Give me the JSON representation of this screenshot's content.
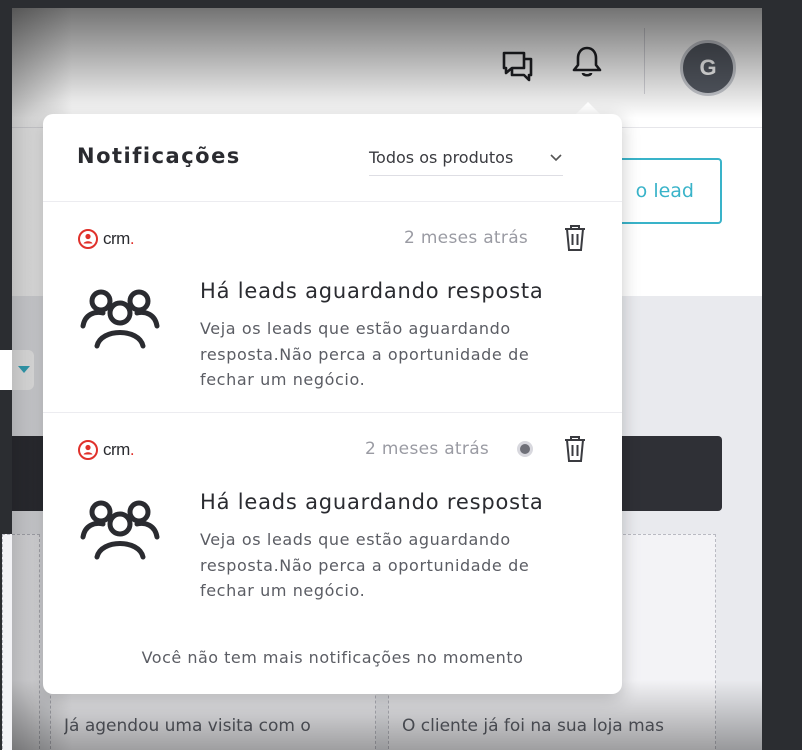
{
  "header": {
    "chat_icon": "chat-bubbles-icon",
    "bell_icon": "bell-icon",
    "avatar_initial": "G"
  },
  "background": {
    "lead_button_label": "o lead",
    "column_1_text": "Já agendou uma visita com o",
    "column_2_text": "O cliente já foi na sua loja mas"
  },
  "notifications_panel": {
    "title": "Notificações",
    "filter": {
      "selected": "Todos os produtos"
    },
    "items": [
      {
        "brand": "crm",
        "brand_dot": ".",
        "time": "2 meses atrás",
        "title": "Há leads aguardando resposta",
        "body": "Veja os leads que estão aguardando resposta.Não perca a oportunidade de fechar um negócio.",
        "unread": false
      },
      {
        "brand": "crm",
        "brand_dot": ".",
        "time": "2 meses atrás",
        "title": "Há leads aguardando resposta",
        "body": "Veja os leads que estão aguardando resposta.Não perca a oportunidade de fechar um negócio.",
        "unread": true
      }
    ],
    "footer": "Você não tem mais notificações no momento"
  },
  "colors": {
    "accent": "#39b3c9",
    "brand_red": "#e0312b",
    "text_dark": "#2a2b30"
  }
}
